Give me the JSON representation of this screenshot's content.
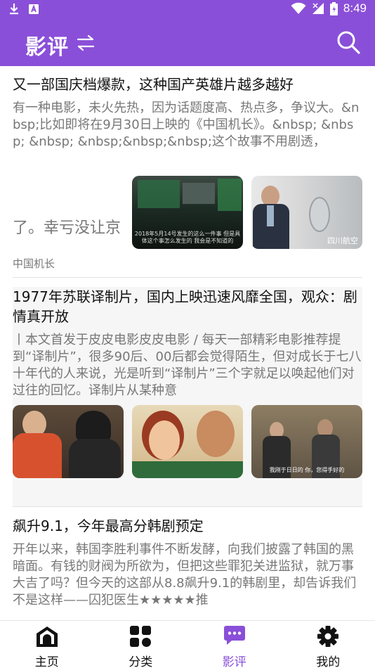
{
  "status_bar": {
    "time": "8:49"
  },
  "app_bar": {
    "title": "影评"
  },
  "articles": [
    {
      "title": "又一部国庆档爆款，这种国产英雄片越多越好",
      "summary": "有一种电影，未火先热，因为话题度高、热点多，争议大。&nbsp;比如即将在9月30日上映的《中国机长》。&nbsp; &nbsp; &nbsp; &nbsp;&nbsp;&nbsp;这个故事不用剧透，",
      "image_text": "了。幸亏没让京",
      "image2_caption": "2018年5月14号发生的这么一件事 但是具体这个事怎么发生的 我会是不知道的",
      "image3_caption": "四川航空",
      "tag": "中国机长"
    },
    {
      "title": "1977年苏联译制片，国内上映迅速风靡全国，观众：剧情真开放",
      "summary": "丨本文首发于皮皮电影皮皮电影 / 每天一部精彩电影推荐提到“译制片”，很多90后、00后都会觉得陌生，但对成长于七八十年代的人来说，光是听到“译制片”三个字就足以唤起他们对过往的回忆。译制片从某种意",
      "image3_caption": "我刚于日日的 你，您得手好的"
    },
    {
      "title": "飙升9.1，今年最高分韩剧预定",
      "summary": "开年以来，韩国李胜利事件不断发酵，向我们披露了韩国的黑暗面。有钱的财阀为所欲为，但把这些罪犯关进监狱，就万事大吉了吗？但今天的这部从8.8飙升9.1的韩剧里，却告诉我们不是这样——囚犯医生★★★★★推"
    }
  ],
  "bottom_nav": [
    {
      "label": "主页",
      "icon": "home-icon",
      "active": false
    },
    {
      "label": "分类",
      "icon": "grid-icon",
      "active": false
    },
    {
      "label": "影评",
      "icon": "chat-bubble-icon",
      "active": true
    },
    {
      "label": "我的",
      "icon": "gear-icon",
      "active": false
    }
  ],
  "colors": {
    "accent": "#8a4fd8"
  }
}
